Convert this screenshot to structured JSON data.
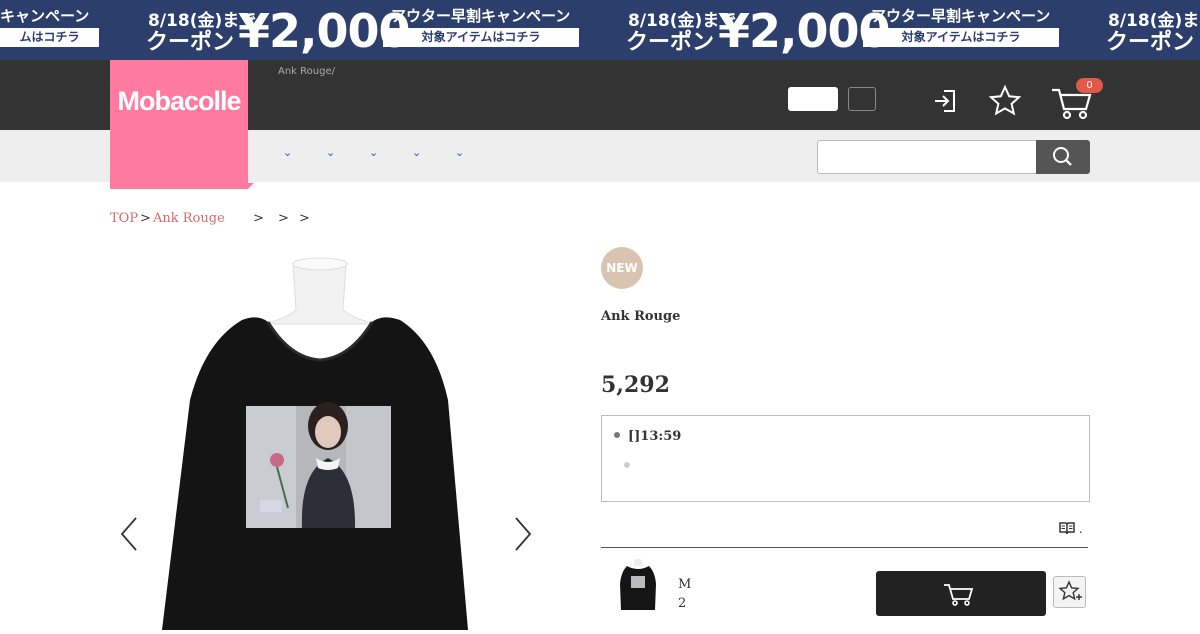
{
  "banner": {
    "date": "8/18(金)まで",
    "coupon": "クーポン",
    "amount": "¥2,000",
    "campaign": "アウター早割キャンペーン",
    "campaign_tail": "キャンペーン",
    "cta": "対象アイテムはコチラ",
    "cta_tail": "ムはコチラ",
    "bg_color": "#2c3e6b"
  },
  "header": {
    "logo": "Mobacolle",
    "breadcrumb_small": "Ank Rouge/",
    "cart_count": "0",
    "logo_color": "#ff7a9e"
  },
  "nav": {
    "chevrons": [
      "⌄",
      "⌄",
      "⌄",
      "⌄",
      "⌄"
    ],
    "search_placeholder": ""
  },
  "breadcrumb": {
    "top": "TOP",
    "sep": ">",
    "brand": "Ank Rouge",
    "trailing": [
      ">",
      ">",
      ">"
    ]
  },
  "product": {
    "badge": "NEW",
    "brand": "Ank Rouge",
    "price": "5,292",
    "info_line": "[]13:59",
    "guide_mark": ".",
    "size": "M",
    "qty": "2"
  },
  "icons": {
    "login": "login-icon",
    "favorite": "star-icon",
    "cart": "cart-icon",
    "search": "search-icon"
  }
}
